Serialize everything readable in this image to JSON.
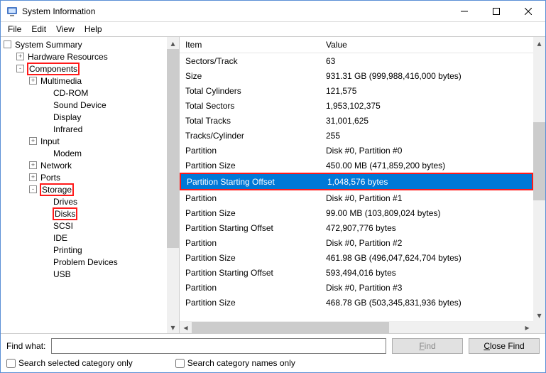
{
  "window": {
    "title": "System Information"
  },
  "menus": {
    "file": "File",
    "edit": "Edit",
    "view": "View",
    "help": "Help"
  },
  "tree": {
    "root": "System Summary",
    "hw": "Hardware Resources",
    "components": "Components",
    "multimedia": "Multimedia",
    "cdrom": "CD-ROM",
    "sound": "Sound Device",
    "display": "Display",
    "infrared": "Infrared",
    "input": "Input",
    "modem": "Modem",
    "network": "Network",
    "ports": "Ports",
    "storage": "Storage",
    "drives": "Drives",
    "disks": "Disks",
    "scsi": "SCSI",
    "ide": "IDE",
    "printing": "Printing",
    "problem": "Problem Devices",
    "usb": "USB"
  },
  "columns": {
    "item": "Item",
    "value": "Value"
  },
  "rows": [
    {
      "item": "Sectors/Track",
      "value": "63"
    },
    {
      "item": "Size",
      "value": "931.31 GB (999,988,416,000 bytes)"
    },
    {
      "item": "Total Cylinders",
      "value": "121,575"
    },
    {
      "item": "Total Sectors",
      "value": "1,953,102,375"
    },
    {
      "item": "Total Tracks",
      "value": "31,001,625"
    },
    {
      "item": "Tracks/Cylinder",
      "value": "255"
    },
    {
      "item": "Partition",
      "value": "Disk #0, Partition #0"
    },
    {
      "item": "Partition Size",
      "value": "450.00 MB (471,859,200 bytes)"
    },
    {
      "item": "Partition Starting Offset",
      "value": "1,048,576 bytes",
      "selected": true,
      "highlight": true
    },
    {
      "item": "Partition",
      "value": "Disk #0, Partition #1"
    },
    {
      "item": "Partition Size",
      "value": "99.00 MB (103,809,024 bytes)"
    },
    {
      "item": "Partition Starting Offset",
      "value": "472,907,776 bytes"
    },
    {
      "item": "Partition",
      "value": "Disk #0, Partition #2"
    },
    {
      "item": "Partition Size",
      "value": "461.98 GB (496,047,624,704 bytes)"
    },
    {
      "item": "Partition Starting Offset",
      "value": "593,494,016 bytes"
    },
    {
      "item": "Partition",
      "value": "Disk #0, Partition #3"
    },
    {
      "item": "Partition Size",
      "value": "468.78 GB (503,345,831,936 bytes)"
    }
  ],
  "footer": {
    "find_label": "Find what:",
    "find_btn": "Find",
    "close_btn": "Close Find",
    "chk1": "Search selected category only",
    "chk2": "Search category names only"
  }
}
